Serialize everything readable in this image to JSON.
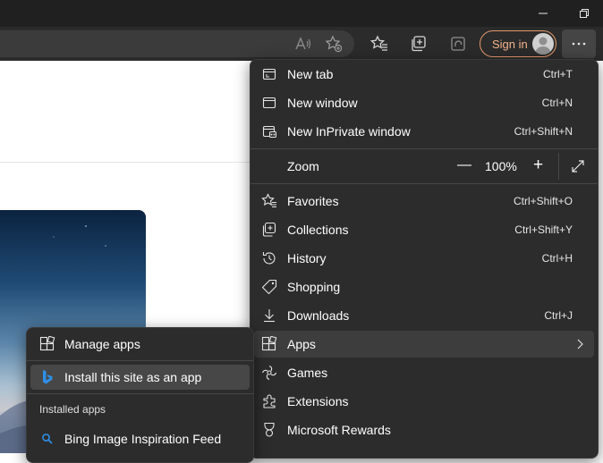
{
  "toolbar": {
    "signin_label": "Sign in"
  },
  "menu": {
    "items_top": [
      {
        "label": "New tab",
        "shortcut": "Ctrl+T",
        "icon": "new-tab-icon"
      },
      {
        "label": "New window",
        "shortcut": "Ctrl+N",
        "icon": "new-window-icon"
      },
      {
        "label": "New InPrivate window",
        "shortcut": "Ctrl+Shift+N",
        "icon": "inprivate-icon"
      }
    ],
    "zoom": {
      "label": "Zoom",
      "minus": "—",
      "value": "100%",
      "plus": "+"
    },
    "items_bottom": [
      {
        "label": "Favorites",
        "shortcut": "Ctrl+Shift+O",
        "icon": "favorites-icon"
      },
      {
        "label": "Collections",
        "shortcut": "Ctrl+Shift+Y",
        "icon": "collections-icon"
      },
      {
        "label": "History",
        "shortcut": "Ctrl+H",
        "icon": "history-icon"
      },
      {
        "label": "Shopping",
        "shortcut": "",
        "icon": "shopping-tag-icon"
      },
      {
        "label": "Downloads",
        "shortcut": "Ctrl+J",
        "icon": "download-icon"
      },
      {
        "label": "Apps",
        "shortcut": "",
        "icon": "apps-icon"
      },
      {
        "label": "Games",
        "shortcut": "",
        "icon": "games-icon"
      },
      {
        "label": "Extensions",
        "shortcut": "",
        "icon": "extensions-icon"
      },
      {
        "label": "Microsoft Rewards",
        "shortcut": "",
        "icon": "rewards-icon"
      }
    ]
  },
  "apps_submenu": {
    "manage_label": "Manage apps",
    "install_label": "Install this site as an app",
    "installed_header": "Installed apps",
    "installed": [
      {
        "label": "Bing Image Inspiration Feed",
        "icon": "search-icon"
      }
    ]
  },
  "colors": {
    "menu_bg": "#2c2c2c",
    "toolbar_bg": "#2b2b2b",
    "titlebar_bg": "#202020",
    "signin_accent": "#e39b6b",
    "bing_blue": "#2f8fe6"
  }
}
